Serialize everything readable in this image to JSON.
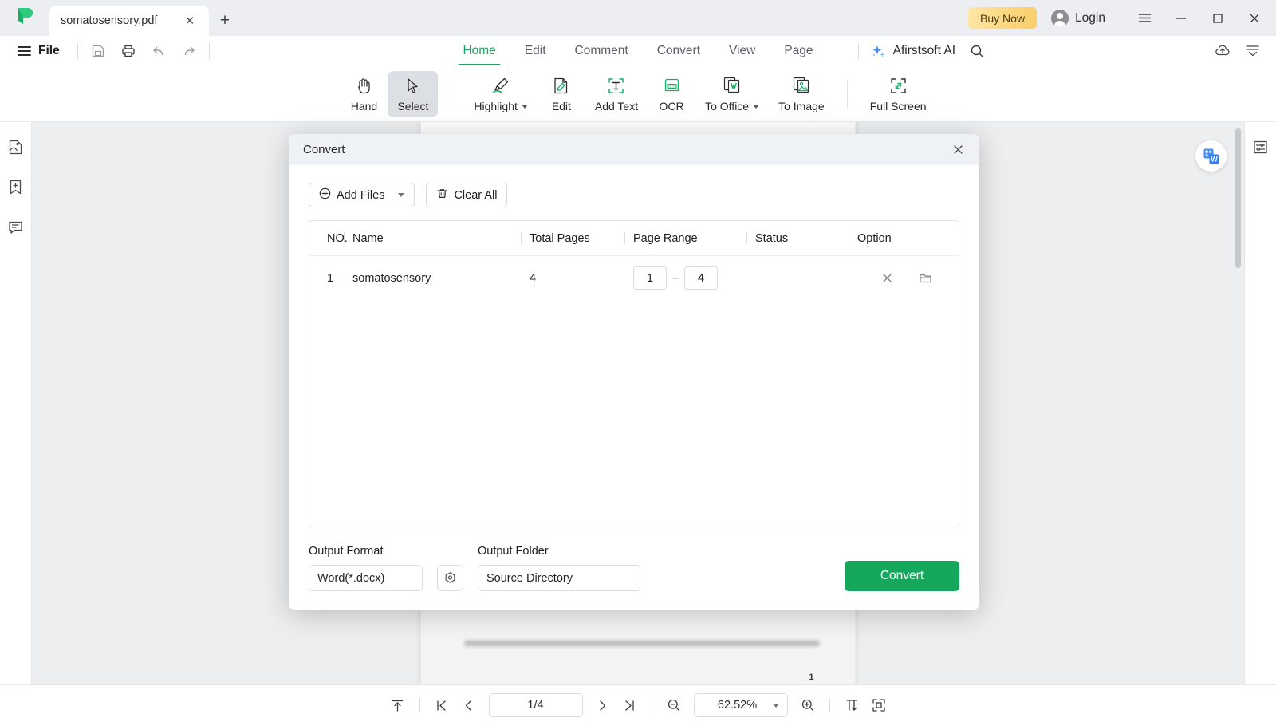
{
  "titlebar": {
    "tab_title": "somatosensory.pdf",
    "close_tab_label": "✕",
    "new_tab_label": "+",
    "buy_now_label": "Buy Now",
    "login_label": "Login",
    "menu_icon": "hamburger-icon",
    "minimize_label": "—",
    "maximize_label": "□",
    "close_label": "✕"
  },
  "menubar": {
    "file_label": "File",
    "icons": [
      "save-icon",
      "print-icon",
      "undo-icon",
      "redo-icon"
    ],
    "tabs": [
      {
        "label": "Home",
        "selected": true
      },
      {
        "label": "Edit",
        "selected": false
      },
      {
        "label": "Comment",
        "selected": false
      },
      {
        "label": "Convert",
        "selected": false
      },
      {
        "label": "View",
        "selected": false
      },
      {
        "label": "Page",
        "selected": false
      }
    ],
    "ai_label": "Afirstsoft AI",
    "search_icon": "search-icon",
    "cloud_icon": "cloud-upload-icon",
    "collapse_icon": "collapse-ribbon-icon"
  },
  "toolbar": {
    "tools": [
      {
        "label": "Hand",
        "icon": "hand-icon",
        "selected": false,
        "has_caret": false
      },
      {
        "label": "Select",
        "icon": "cursor-icon",
        "selected": true,
        "has_caret": false
      },
      {
        "label": "Highlight",
        "icon": "highlighter-icon",
        "selected": false,
        "has_caret": true
      },
      {
        "label": "Edit",
        "icon": "edit-document-icon",
        "selected": false,
        "has_caret": false
      },
      {
        "label": "Add Text",
        "icon": "add-text-icon",
        "selected": false,
        "has_caret": false
      },
      {
        "label": "OCR",
        "icon": "ocr-icon",
        "selected": false,
        "has_caret": false
      },
      {
        "label": "To Office",
        "icon": "to-office-icon",
        "selected": false,
        "has_caret": true
      },
      {
        "label": "To Image",
        "icon": "to-image-icon",
        "selected": false,
        "has_caret": false
      },
      {
        "label": "Full Screen",
        "icon": "full-screen-icon",
        "selected": false,
        "has_caret": false
      }
    ]
  },
  "sidebar_left": {
    "items": [
      {
        "icon": "thumbnail-icon"
      },
      {
        "icon": "bookmark-add-icon"
      },
      {
        "icon": "comment-icon"
      }
    ]
  },
  "sidebar_right": {
    "items": [
      {
        "icon": "properties-panel-icon"
      }
    ]
  },
  "viewer": {
    "word_badge_icon": "word-convert-badge-icon",
    "page_number_mark": "1"
  },
  "modal": {
    "title": "Convert",
    "close_icon": "close-icon",
    "add_files_label": "Add Files",
    "add_files_icon": "plus-circle-icon",
    "clear_all_label": "Clear All",
    "clear_all_icon": "trash-icon",
    "table": {
      "headers": [
        "NO.",
        "Name",
        "Total Pages",
        "Page Range",
        "Status",
        "Option"
      ],
      "rows": [
        {
          "no": "1",
          "name": "somatosensory",
          "total_pages": "4",
          "range_from": "1",
          "range_to": "4",
          "range_sep": "–",
          "status": "",
          "remove_icon": "close-icon",
          "folder_icon": "folder-open-icon"
        }
      ]
    },
    "output_format_label": "Output Format",
    "output_format_value": "Word(*.docx)",
    "settings_icon": "settings-gear-icon",
    "output_folder_label": "Output Folder",
    "output_folder_value": "Source Directory",
    "convert_label": "Convert"
  },
  "statusbar": {
    "scroll_top_icon": "scroll-to-top-icon",
    "first_page_icon": "first-page-icon",
    "prev_page_icon": "prev-page-icon",
    "page_value": "1/4",
    "next_page_icon": "next-page-icon",
    "last_page_icon": "last-page-icon",
    "zoom_out_icon": "zoom-out-icon",
    "zoom_value": "62.52%",
    "zoom_in_icon": "zoom-in-icon",
    "fit_width_icon": "fit-width-icon",
    "fit_page_icon": "fit-page-icon"
  },
  "colors": {
    "accent_green": "#15a85d",
    "tab_active_green": "#1aa362",
    "buy_now_gold": "#fbd77f",
    "titlebar_bg": "#eceef1",
    "viewer_bg": "#eceef0",
    "modal_head_bg": "#eef1f6"
  }
}
